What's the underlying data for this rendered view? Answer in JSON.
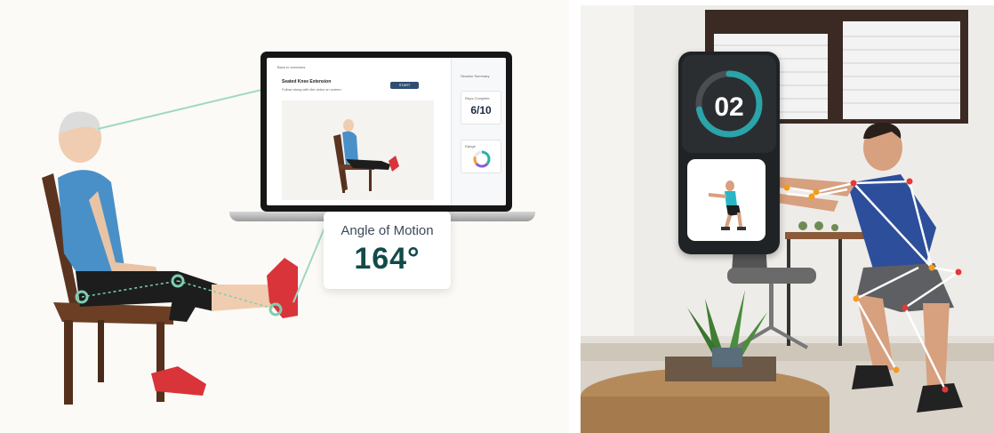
{
  "left_panel": {
    "laptop_app": {
      "back_link": "Back to exercises",
      "exercise_title": "Seated Knee Extension",
      "instruction": "Follow along with the video on screen",
      "start_button": "START",
      "side_header": "Session Summary",
      "reps_label": "Reps Complete",
      "reps_value": "6/10",
      "range_label": "Range",
      "ring_colors": [
        "#2bb0a8",
        "#8a5cd6",
        "#f39c3d",
        "#e8e8e8"
      ]
    },
    "angle_card": {
      "title": "Angle of Motion",
      "value": "164°"
    },
    "tracking_color": "#7ccfb0"
  },
  "right_panel": {
    "rep_counter": {
      "count": "02",
      "progress": 0.72,
      "ring_color": "#2aa3a9",
      "track_color": "#4a4e52"
    },
    "pose_color_lines": "#ffffff",
    "pose_color_joints": [
      "#f39c1f",
      "#e53935"
    ]
  }
}
